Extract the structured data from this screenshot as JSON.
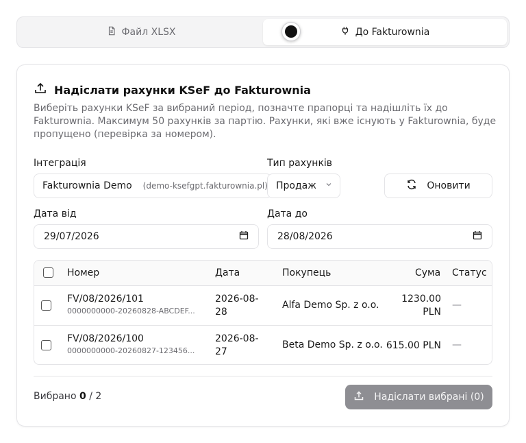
{
  "tabs": [
    {
      "label": "Файл XLSX",
      "icon": "file-icon",
      "active": false
    },
    {
      "label": "До Fakturownia",
      "icon": "plug-icon",
      "active": true
    }
  ],
  "card": {
    "title": "Надіслати рахунки KSeF до Fakturownia",
    "description": "Виберіть рахунки KSeF за вибраний період, позначте прапорці та надішліть їх до Fakturownia. Максимум 50 рахунків за партію. Рахунки, які вже існують у Fakturownia, буде пропущено (перевірка за номером)."
  },
  "form": {
    "integration_label": "Інтеграція",
    "integration_value": "Fakturownia Demo",
    "integration_domain": "(demo-ksefgpt.fakturownia.pl)",
    "type_label": "Тип рахунків",
    "type_value": "Продаж",
    "refresh_label": "Оновити",
    "date_from_label": "Дата від",
    "date_from_value": "29/07/2026",
    "date_to_label": "Дата до",
    "date_to_value": "28/08/2026"
  },
  "table": {
    "headers": {
      "number": "Номер",
      "date": "Дата",
      "buyer": "Покупець",
      "amount": "Сума",
      "status": "Статус"
    },
    "rows": [
      {
        "number": "FV/08/2026/101",
        "ksef_id": "0000000000-20260828-ABCDEF...",
        "date_line1": "2026-08-",
        "date_line2": "28",
        "buyer": "Alfa Demo Sp. z o.o.",
        "amount_line1": "1230.00",
        "amount_line2": "PLN",
        "status": "—",
        "checked": false
      },
      {
        "number": "FV/08/2026/100",
        "ksef_id": "0000000000-20260827-123456...",
        "date_line1": "2026-08-",
        "date_line2": "27",
        "buyer": "Beta Demo Sp. z o.o.",
        "amount_line1": "615.00 PLN",
        "amount_line2": "",
        "status": "—",
        "checked": false
      }
    ]
  },
  "footer": {
    "selected_label": "Вибрано",
    "selected_count": "0",
    "selected_total": "/ 2",
    "send_label": "Надіслати вибрані (0)"
  },
  "colors": {
    "send_button_bg": "#8e8e93",
    "border": "#e4e4e7",
    "muted_text": "#6b6b70"
  }
}
